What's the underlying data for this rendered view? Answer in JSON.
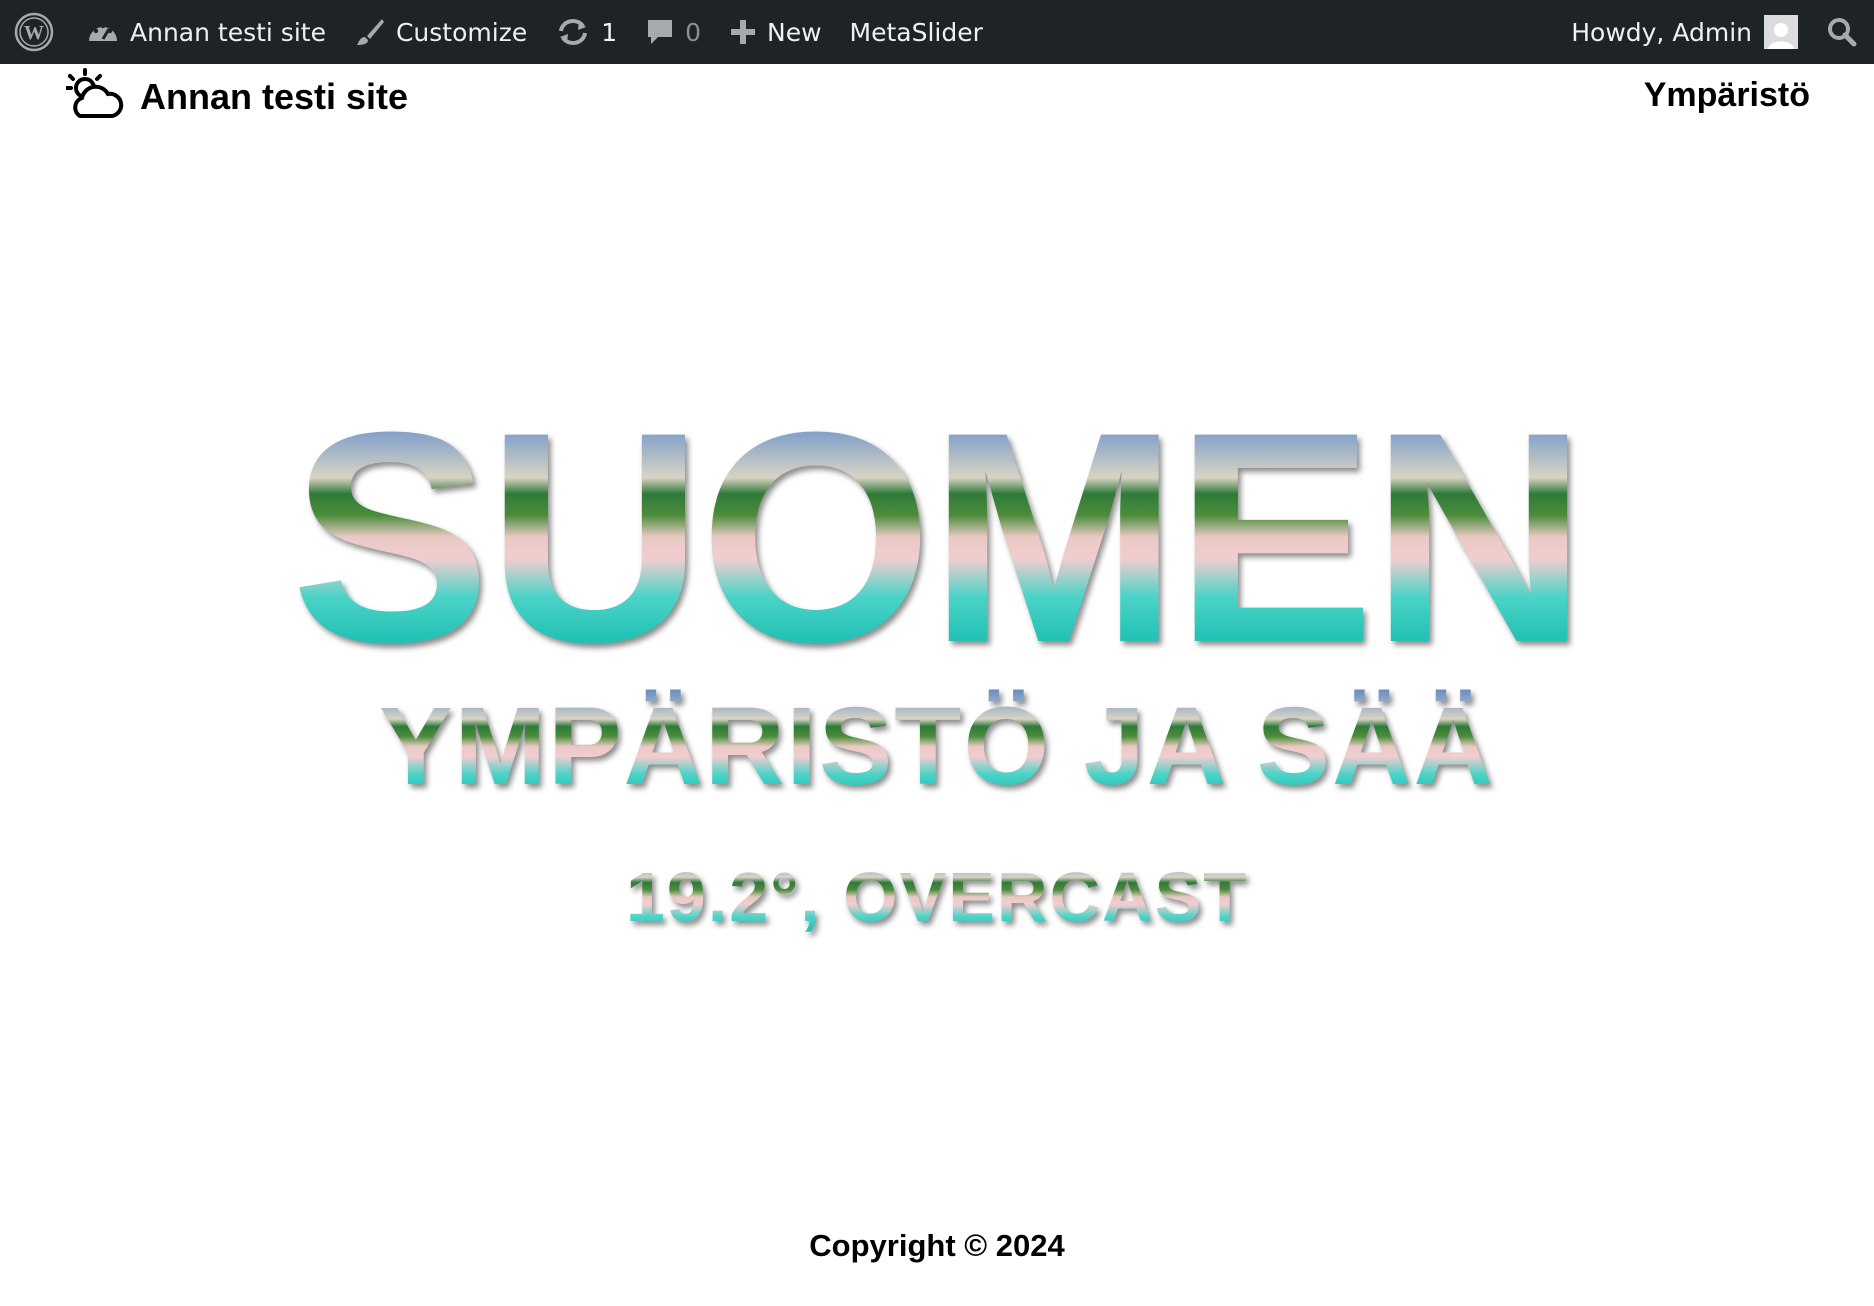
{
  "admin_bar": {
    "wp_logo": "wordpress-logo-icon",
    "site_name": "Annan testi site",
    "customize": "Customize",
    "updates_count": "1",
    "comments_count": "0",
    "new_label": "New",
    "metaslider": "MetaSlider",
    "howdy": "Howdy, Admin",
    "background": "#1d2327"
  },
  "header": {
    "site_title": "Annan testi site",
    "logo_icon": "sun-cloud-icon",
    "nav_link": "Ympäristö"
  },
  "hero": {
    "title": "SUOMEN",
    "subtitle": "YMPÄRISTÖ JA SÄÄ",
    "weather": "19.2°, OVERCAST",
    "fill": "beach photo texture"
  },
  "footer": {
    "copyright": "Copyright © 2024"
  }
}
